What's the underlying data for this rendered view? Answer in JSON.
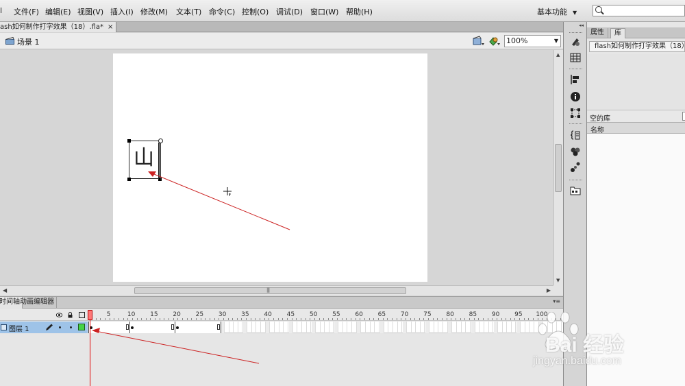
{
  "menubar": {
    "app_icon_fragment": "l",
    "items": [
      {
        "label": "文件(F)"
      },
      {
        "label": "编辑(E)"
      },
      {
        "label": "视图(V)"
      },
      {
        "label": "插入(I)"
      },
      {
        "label": "修改(M)"
      },
      {
        "label": "文本(T)"
      },
      {
        "label": "命令(C)"
      },
      {
        "label": "控制(O)"
      },
      {
        "label": "调试(D)"
      },
      {
        "label": "窗口(W)"
      },
      {
        "label": "帮助(H)"
      }
    ],
    "workspace_label": "基本功能",
    "workspace_caret": "▼",
    "search_placeholder": ""
  },
  "document": {
    "tab_label": "ash如何制作打字效果（18）.fla*",
    "close_glyph": "×"
  },
  "scene_bar": {
    "scene_label": "场景 1",
    "zoom_value": "100%",
    "zoom_caret": "▼"
  },
  "stage": {
    "background": "#ffffff",
    "text_box_char": "山",
    "annotation_color": "#cc2222"
  },
  "scrollbars": {
    "v_up": "▲",
    "v_down": "▼",
    "h_left": "◀",
    "h_right": "▶",
    "grip": "|||"
  },
  "timeline": {
    "tabs": [
      {
        "label": "时间轴"
      },
      {
        "label": "动画编辑器"
      }
    ],
    "panel_menu": "▾≡",
    "frame_numbers": [
      "1",
      "5",
      "10",
      "15",
      "20",
      "25",
      "30",
      "35",
      "40",
      "45",
      "50",
      "55",
      "60",
      "65",
      "70",
      "75",
      "80",
      "85",
      "90",
      "95",
      "100"
    ],
    "layer": {
      "name": "图层 1",
      "outline_color": "#46d346",
      "selected_color": "#9ec3e8"
    },
    "playhead_color": "#e00000"
  },
  "toolstrip": {
    "collapse_glyph": "◂◂",
    "tools": [
      "swatches-icon",
      "grid-align-icon",
      "align-icon",
      "info-icon",
      "transform-icon",
      "code-snippets-icon",
      "components-icon",
      "motion-presets-icon",
      "library-icon"
    ]
  },
  "right_panel": {
    "tabs": [
      {
        "label": "属性"
      },
      {
        "label": "库"
      }
    ],
    "library_document": "flash如何制作打字效果（18）",
    "library_status": "空的库",
    "column_name": "名称"
  },
  "watermark": {
    "logo_text": "Bai 经验",
    "url_text": "jingyan.baidu.com"
  }
}
